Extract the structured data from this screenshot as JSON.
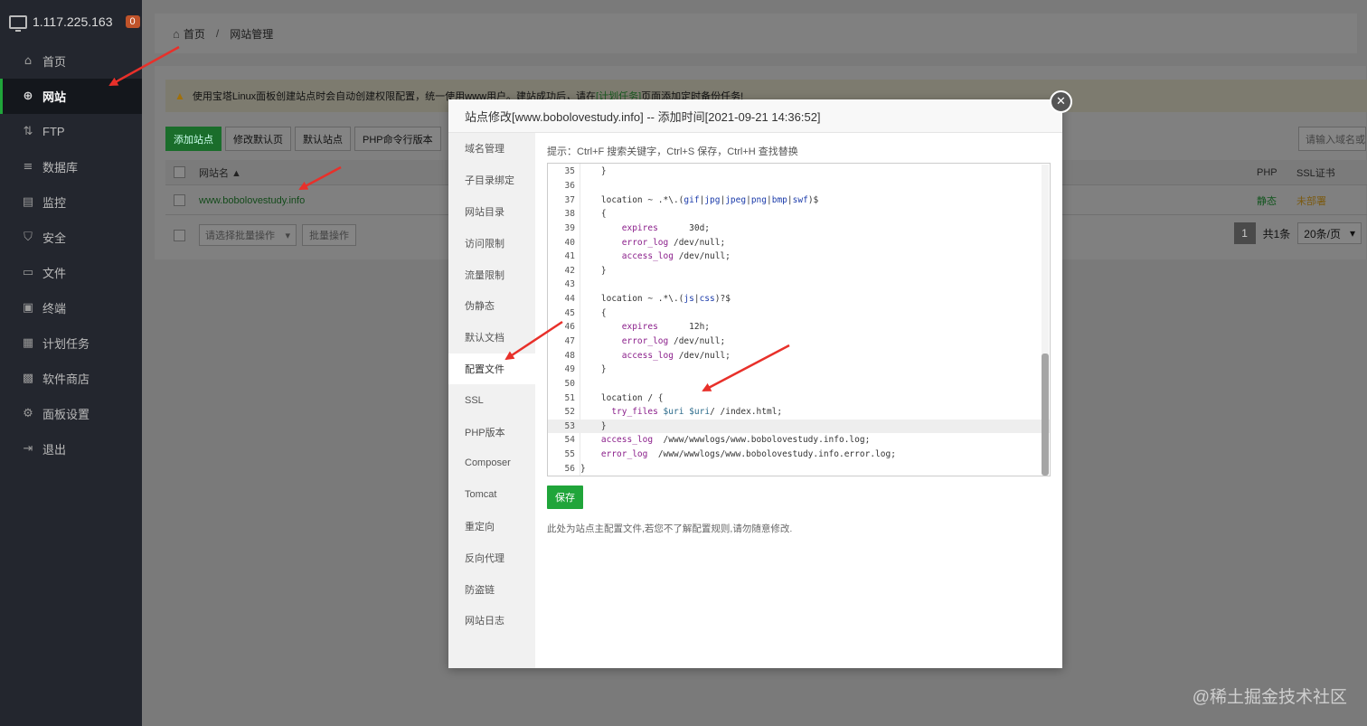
{
  "sidebar": {
    "ip": "1.117.225.163",
    "badge": "0",
    "items": [
      {
        "label": "首页",
        "icon": "home-icon",
        "glyph": "⌂"
      },
      {
        "label": "网站",
        "icon": "globe-icon",
        "glyph": "⊕"
      },
      {
        "label": "FTP",
        "icon": "ftp-icon",
        "glyph": "⇅"
      },
      {
        "label": "数据库",
        "icon": "database-icon",
        "glyph": "≡"
      },
      {
        "label": "监控",
        "icon": "monitor-icon",
        "glyph": "▤"
      },
      {
        "label": "安全",
        "icon": "shield-icon",
        "glyph": "⛉"
      },
      {
        "label": "文件",
        "icon": "folder-icon",
        "glyph": "▭"
      },
      {
        "label": "终端",
        "icon": "terminal-icon",
        "glyph": "▣"
      },
      {
        "label": "计划任务",
        "icon": "calendar-icon",
        "glyph": "▦"
      },
      {
        "label": "软件商店",
        "icon": "apps-icon",
        "glyph": "▩"
      },
      {
        "label": "面板设置",
        "icon": "gear-icon",
        "glyph": "⚙"
      },
      {
        "label": "退出",
        "icon": "logout-icon",
        "glyph": "⇥"
      }
    ],
    "active_index": 1
  },
  "breadcrumb": {
    "home": "首页",
    "sep": "/",
    "current": "网站管理"
  },
  "notice": {
    "prefix": "使用宝塔Linux面板创建站点时会自动创建权限配置，统一使用www用户。建站成功后，请在",
    "link": "[计划任务]",
    "suffix": "页面添加定时备份任务!"
  },
  "toolbar": {
    "add_site": "添加站点",
    "modify_default_page": "修改默认页",
    "default_site": "默认站点",
    "php_cli": "PHP命令行版本",
    "search_placeholder": "请输入域名或"
  },
  "table": {
    "col_site": "网站名 ▲",
    "col_php": "PHP",
    "col_ssl": "SSL证书",
    "rows": [
      {
        "site": "www.bobolovestudy.info",
        "php": "静态",
        "ssl": "未部署"
      }
    ]
  },
  "footer": {
    "batch_select": "请选择批量操作",
    "batch_btn": "批量操作",
    "page": "1",
    "total": "共1条",
    "per_page": "20条/页"
  },
  "dialog": {
    "title": "站点修改[www.bobolovestudy.info] -- 添加时间[2021-09-21 14:36:52]",
    "menu": [
      "域名管理",
      "子目录绑定",
      "网站目录",
      "访问限制",
      "流量限制",
      "伪静态",
      "默认文档",
      "配置文件",
      "SSL",
      "PHP版本",
      "Composer",
      "Tomcat",
      "重定向",
      "反向代理",
      "防盗链",
      "网站日志"
    ],
    "active_menu": 7,
    "hint": "提示：Ctrl+F 搜索关键字，Ctrl+S 保存，Ctrl+H 查找替换",
    "save": "保存",
    "note": "此处为站点主配置文件,若您不了解配置规则,请勿随意修改.",
    "highlighted_line": 53,
    "code_lines": [
      {
        "n": "35",
        "t": "    }"
      },
      {
        "n": "36",
        "t": ""
      },
      {
        "n": "37",
        "t": "    location ~ .*\\.(gif|jpg|jpeg|png|bmp|swf)$"
      },
      {
        "n": "38",
        "t": "    {"
      },
      {
        "n": "39",
        "t": "        expires      30d;"
      },
      {
        "n": "40",
        "t": "        error_log /dev/null;"
      },
      {
        "n": "41",
        "t": "        access_log /dev/null;"
      },
      {
        "n": "42",
        "t": "    }"
      },
      {
        "n": "43",
        "t": ""
      },
      {
        "n": "44",
        "t": "    location ~ .*\\.(js|css)?$"
      },
      {
        "n": "45",
        "t": "    {"
      },
      {
        "n": "46",
        "t": "        expires      12h;"
      },
      {
        "n": "47",
        "t": "        error_log /dev/null;"
      },
      {
        "n": "48",
        "t": "        access_log /dev/null;"
      },
      {
        "n": "49",
        "t": "    }"
      },
      {
        "n": "50",
        "t": ""
      },
      {
        "n": "51",
        "t": "    location / {"
      },
      {
        "n": "52",
        "t": "      try_files $uri $uri/ /index.html;"
      },
      {
        "n": "53",
        "t": "    }"
      },
      {
        "n": "54",
        "t": "    access_log  /www/wwwlogs/www.bobolovestudy.info.log;"
      },
      {
        "n": "55",
        "t": "    error_log  /www/wwwlogs/www.bobolovestudy.info.error.log;"
      },
      {
        "n": "56",
        "t": "}"
      }
    ]
  },
  "watermark": "@稀土掘金技术社区",
  "colors": {
    "accent": "#20a53a",
    "arrow": "#e8302a",
    "sidebar": "#23262e"
  }
}
